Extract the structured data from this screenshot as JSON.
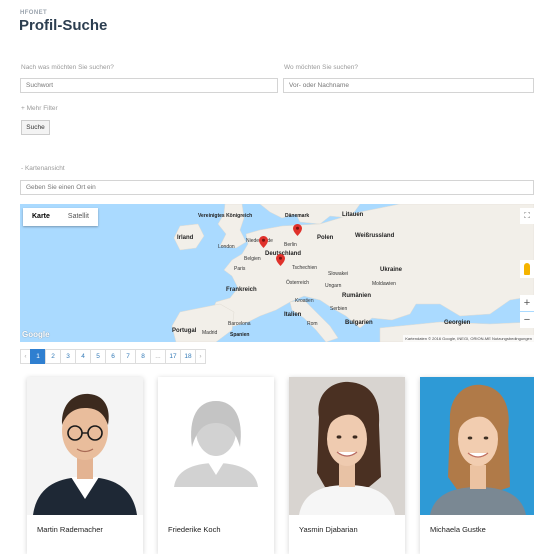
{
  "header": {
    "brand": "HFONET",
    "title": "Profil-Suche"
  },
  "search": {
    "what_label": "Nach was möchten Sie suchen?",
    "what_placeholder": "Suchwort",
    "where_label": "Wo möchten Sie suchen?",
    "where_placeholder": "Vor- oder Nachname",
    "more_filters": "+ Mehr Filter",
    "submit": "Suche"
  },
  "map_section": {
    "toggle": "-  Kartenansicht",
    "location_placeholder": "Geben Sie einen Ort ein",
    "tabs": [
      "Karte",
      "Satellit"
    ],
    "logo": "Google",
    "attribution": "Kartendaten © 2016 Google, INEGI, ORION-ME  Nutzungsbedingungen",
    "countries": [
      "Vereinigtes Königreich",
      "Irland",
      "Dänemark",
      "Litauen",
      "Polen",
      "Weißrussland",
      "Deutschland",
      "Ukraine",
      "Frankreich",
      "Rumänien",
      "Italien",
      "Bulgarien",
      "Portugal",
      "Spanien",
      "Georgien"
    ],
    "cities": [
      "London",
      "Niederlande",
      "Belgien",
      "Paris",
      "Berlin",
      "Österreich",
      "Tschechien",
      "Ungarn",
      "Slowakei",
      "Moldawien",
      "Kroatien",
      "Serbien",
      "Madrid",
      "Barcelona",
      "Rom"
    ],
    "colors": {
      "water": "#aadaff",
      "land": "#f2efe9",
      "pin": "#e0312b"
    }
  },
  "pagination": {
    "prev": "‹",
    "pages": [
      "1",
      "2",
      "3",
      "4",
      "5",
      "6",
      "7",
      "8",
      "...",
      "17",
      "18"
    ],
    "next": "›",
    "active_page": "1",
    "active_color": "#2f7fd0"
  },
  "profiles": [
    {
      "name": "Martin Rademacher"
    },
    {
      "name": "Friederike Koch"
    },
    {
      "name": "Yasmin Djabarian"
    },
    {
      "name": "Michaela Gustke"
    }
  ]
}
